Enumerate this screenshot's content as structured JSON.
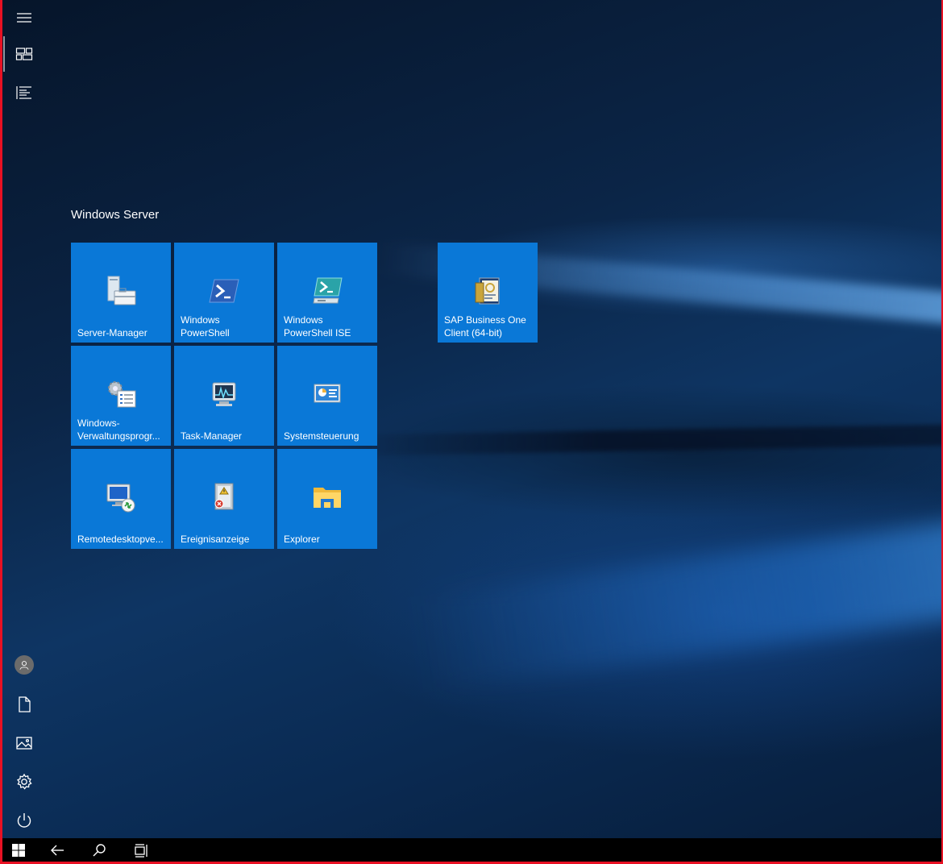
{
  "start": {
    "group_title": "Windows Server",
    "tiles": [
      {
        "label": "Server-Manager",
        "icon": "server-manager-icon"
      },
      {
        "label": "Windows\nPowerShell",
        "icon": "powershell-icon"
      },
      {
        "label": "Windows\nPowerShell ISE",
        "icon": "powershell-ise-icon"
      },
      {
        "label": "SAP Business One\nClient (64-bit)",
        "icon": "sap-business-one-icon"
      },
      {
        "label": "Windows-\nVerwaltungsprogr...",
        "icon": "admin-tools-icon"
      },
      {
        "label": "Task-Manager",
        "icon": "task-manager-icon"
      },
      {
        "label": "Systemsteuerung",
        "icon": "control-panel-icon"
      },
      {
        "label": "Remotedesktopve...",
        "icon": "remote-desktop-icon"
      },
      {
        "label": "Ereignisanzeige",
        "icon": "event-viewer-icon"
      },
      {
        "label": "Explorer",
        "icon": "file-explorer-icon"
      }
    ],
    "tile_color": "#0a78d7"
  },
  "sidebar": {
    "icons": [
      "hamburger-menu-icon",
      "tiles-view-icon",
      "all-apps-list-icon",
      "user-account-icon",
      "documents-icon",
      "pictures-icon",
      "settings-gear-icon",
      "power-icon"
    ]
  },
  "taskbar": {
    "icons": [
      "windows-start-icon",
      "back-arrow-icon",
      "search-icon",
      "task-view-icon"
    ]
  },
  "frame_color": "#e81123"
}
